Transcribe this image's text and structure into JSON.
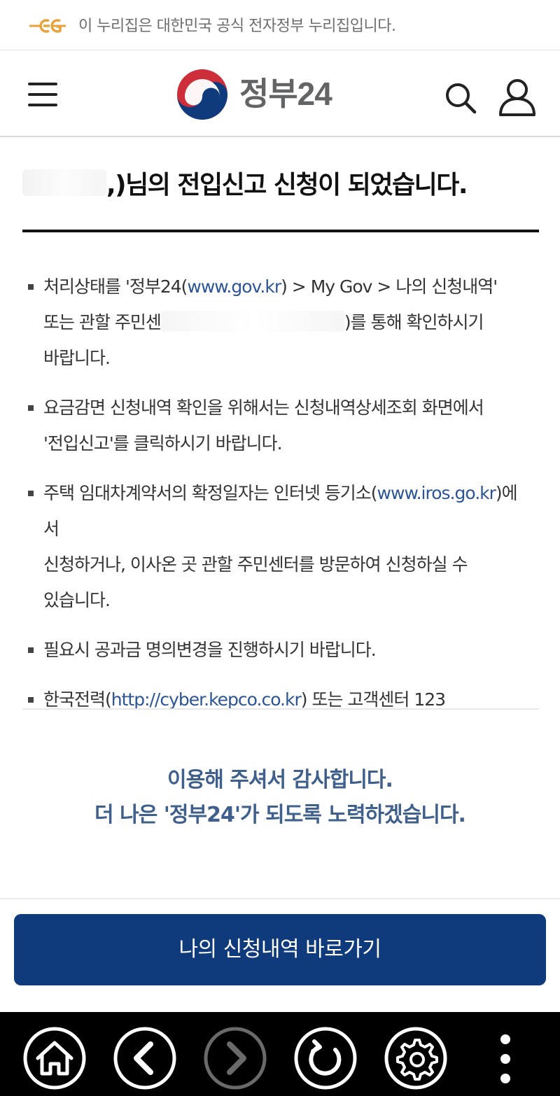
{
  "gov_banner": {
    "text": "이 누리집은 대한민국 공식 전자정부 누리집입니다."
  },
  "header": {
    "logo_text": "정부24"
  },
  "result": {
    "title_suffix": ",)님의 전입신고 신청이 되었습니다."
  },
  "notices": [
    {
      "pre": "처리상태를 '정부24(",
      "link": "www.gov.kr",
      "post": ") > My Gov > 나의 신청내역'",
      "line2_pre": "또는 관할 주민센",
      "line2_post": ")를 통해 확인하시기",
      "line3": "바랍니다."
    },
    {
      "line1": "요금감면 신청내역 확인을 위해서는 신청내역상세조회 화면에서",
      "line2": "'전입신고'를 클릭하시기 바랍니다."
    },
    {
      "pre": "주택 임대차계약서의 확정일자는 인터넷 등기소(",
      "link": "www.iros.go.kr",
      "post": ")에서",
      "line2": "신청하거나, 이사온 곳 관할 주민센터를 방문하여 신청하실 수",
      "line3": "있습니다."
    },
    {
      "text": "필요시 공과금 명의변경을 진행하시기 바랍니다."
    },
    {
      "pre": "한국전력(",
      "link": "http://cyber.kepco.co.kr",
      "post": ") 또는 고객센터 123"
    }
  ],
  "thanks": {
    "line1": "이용해 주셔서 감사합니다.",
    "line2": "더 나은 '정부24'가 되도록 노력하겠습니다."
  },
  "cta": {
    "label": "나의 신청내역 바로가기"
  },
  "colors": {
    "primary_button": "#0f3a7b",
    "link": "#2b5597",
    "thanks_text": "#3f5f8c",
    "logo_red": "#cd2e3a",
    "logo_blue": "#0f3a7b",
    "banner_gold": "#e8a23a"
  },
  "icons": {
    "banner": "eg-logo",
    "menu": "hamburger-menu-icon",
    "search": "search-icon",
    "user": "user-icon",
    "nav": [
      "home-icon",
      "back-icon",
      "forward-icon",
      "refresh-icon",
      "settings-icon",
      "more-icon"
    ]
  }
}
